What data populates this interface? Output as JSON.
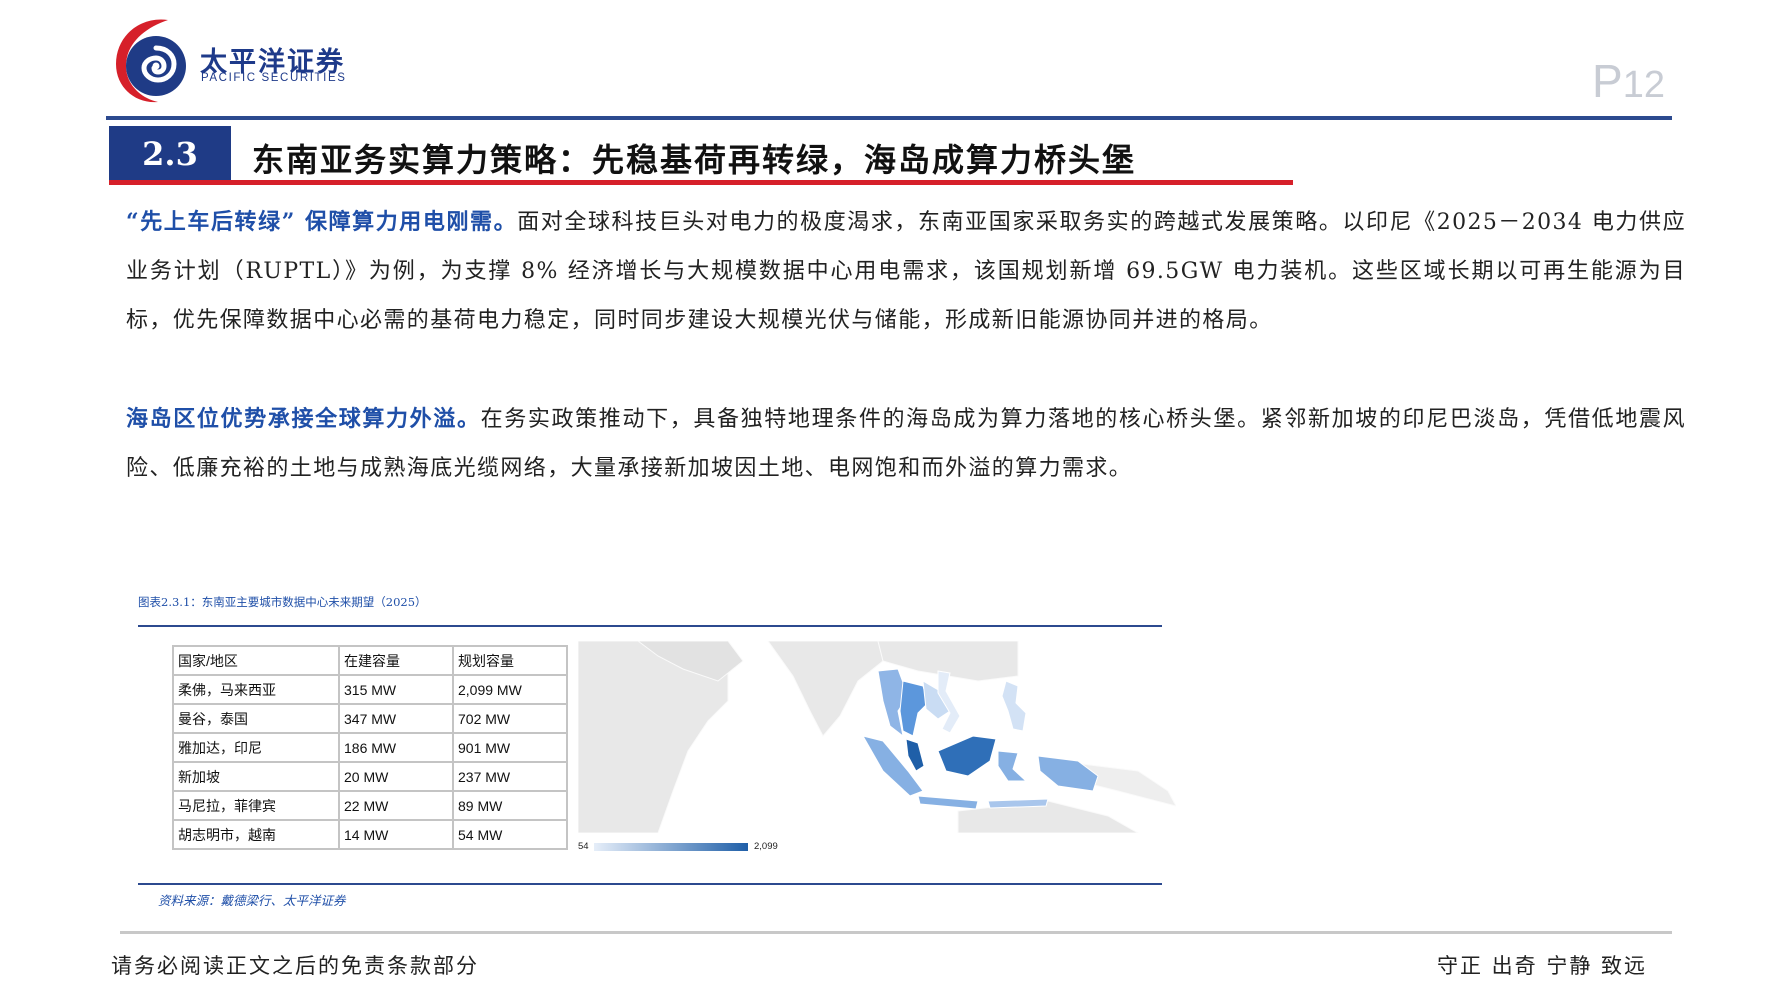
{
  "header": {
    "brand_cn": "太平洋证券",
    "brand_en": "PACIFIC SECURITIES",
    "page_prefix": "P",
    "page_number": "12",
    "logo_icon": "pacific-securities-logo"
  },
  "section": {
    "number": "2.3",
    "title": "东南亚务实算力策略：先稳基荷再转绿，海岛成算力桥头堡"
  },
  "body": {
    "p1_highlight": "“先上车后转绿” 保障算力用电刚需。",
    "p1_text": "面对全球科技巨头对电力的极度渴求，东南亚国家采取务实的跨越式发展策略。以印尼《2025－2034 电力供应业务计划（RUPTL）》为例，为支撑 8% 经济增长与大规模数据中心用电需求，该国规划新增 69.5GW 电力装机。这些区域长期以可再生能源为目标，优先保障数据中心必需的基荷电力稳定，同时同步建设大规模光伏与储能，形成新旧能源协同并进的格局。",
    "p2_highlight": "海岛区位优势承接全球算力外溢。",
    "p2_text": "在务实政策推动下，具备独特地理条件的海岛成为算力落地的核心桥头堡。紧邻新加坡的印尼巴淡岛，凭借低地震风险、低廉充裕的土地与成熟海底光缆网络，大量承接新加坡因土地、电网饱和而外溢的算力需求。"
  },
  "figure": {
    "caption": "图表2.3.1：东南亚主要城市数据中心未来期望（2025）",
    "source": "资料来源：戴德梁行、太平洋证券",
    "table": {
      "headers": [
        "国家/地区",
        "在建容量",
        "规划容量"
      ],
      "rows": [
        [
          "柔佛，马来西亚",
          "315 MW",
          "2,099 MW"
        ],
        [
          "曼谷，泰国",
          "347 MW",
          "702 MW"
        ],
        [
          "雅加达，印尼",
          "186 MW",
          "901 MW"
        ],
        [
          "新加坡",
          "20 MW",
          "237 MW"
        ],
        [
          "马尼拉，菲律宾",
          "22 MW",
          "89 MW"
        ],
        [
          "胡志明市，越南",
          "14 MW",
          "54 MW"
        ]
      ]
    },
    "map": {
      "legend_min": "54",
      "legend_max": "2,099",
      "color_low": "#e6eef9",
      "color_high": "#1f5fa8"
    }
  },
  "footer": {
    "left": "请务必阅读正文之后的免责条款部分",
    "right": "守正 出奇 宁静 致远"
  }
}
